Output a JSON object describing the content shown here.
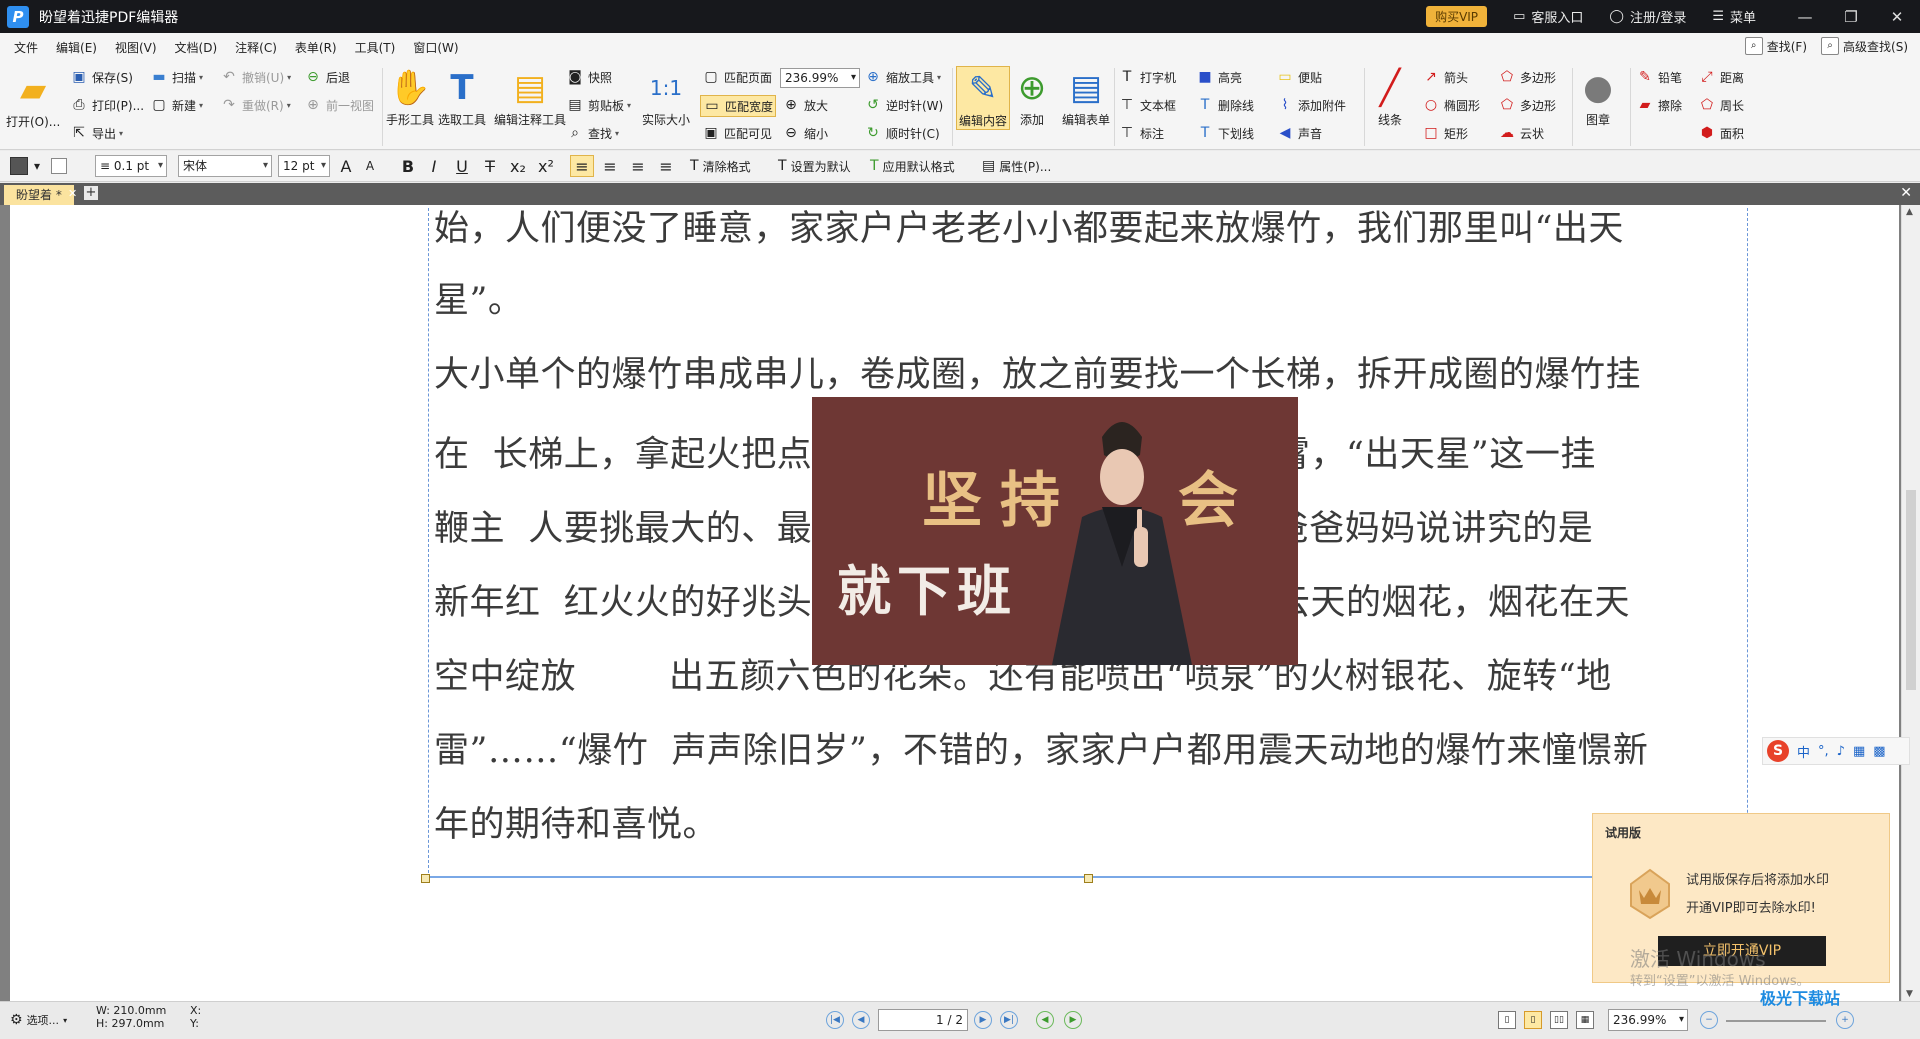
{
  "window": {
    "title": "盼望着迅捷PDF编辑器",
    "vip_button": "购买VIP",
    "service": "客服入口",
    "login": "注册/登录",
    "menu": "菜单"
  },
  "menubar": {
    "items": [
      "文件",
      "编辑(E)",
      "视图(V)",
      "文档(D)",
      "注释(C)",
      "表单(R)",
      "工具(T)",
      "窗口(W)"
    ],
    "find": "查找(F)",
    "advanced_find": "高级查找(S)"
  },
  "ribbon": {
    "open": "打开(O)...",
    "save": "保存(S)",
    "print": "打印(P)...",
    "export": "导出",
    "scan": "扫描",
    "new": "新建",
    "undo": "撤销(U)",
    "redo": "重做(R)",
    "back": "后退",
    "prev_view": "前一视图",
    "hand_tool": "手形工具",
    "select_tool": "选取工具",
    "annot_select": "编辑注释工具",
    "snapshot": "快照",
    "clipboard": "剪贴板",
    "find": "查找",
    "actual_size": "实际大小",
    "fit_page": "匹配页面",
    "fit_width": "匹配宽度",
    "fit_visible": "匹配可见",
    "zoom_value": "236.99%",
    "zoom_in": "放大",
    "zoom_out": "缩小",
    "zoom_tool": "缩放工具",
    "rotate_ccw": "逆时针(W)",
    "rotate_cw": "顺时针(C)",
    "edit_content": "编辑内容",
    "add": "添加",
    "edit_form": "编辑表单",
    "typewriter": "打字机",
    "textbox": "文本框",
    "callout": "标注",
    "highlight": "高亮",
    "strikeout": "删除线",
    "underline": "下划线",
    "note": "便贴",
    "attach": "添加附件",
    "sound": "声音",
    "line": "线条",
    "arrow": "箭头",
    "ellipse": "椭圆形",
    "rect": "矩形",
    "polygon": "多边形",
    "polyline": "多边形",
    "cloud": "云状",
    "stamp": "图章",
    "pencil": "铅笔",
    "eraser": "擦除",
    "distance": "距离",
    "perimeter": "周长",
    "area": "面积"
  },
  "formatbar": {
    "line_width": "0.1 pt",
    "font": "宋体",
    "size": "12 pt",
    "clear_format": "清除格式",
    "set_default": "设置为默认",
    "apply_default": "应用默认格式",
    "properties": "属性(P)..."
  },
  "tabs": {
    "doc": "盼望着 *"
  },
  "document": {
    "lines": [
      "始，人们便没了睡意，家家户户老老小小都要起来放爆竹，我们那里叫“出天",
      "星”。",
      "大小单个的爆竹串成串儿，卷成圈，放之前要找一个长梯，拆开成圈的爆竹挂",
      "在  长梯上，拿起火把点燃导火线，“噼里啪啦”响彻云霄，“出天星”这一挂",
      "鞭主  人要挑最大的、最响的，点火把也要挑旺的，听爸爸妈妈说讲究的是",
      "新年红  红火火的好兆头。“出天星”后我们还放了直窜云天的烟花，烟花在天",
      "空中绽放        出五颜六色的花朵。还有能喷出“喷泉”的火树银花、旋转“地",
      "雷”……“爆竹  声声除旧岁”，不错的，家家户户都用震天动地的爆竹来憧憬新",
      "年的期待和喜悦。"
    ],
    "overlay_text1": "坚持",
    "overlay_text2": "会",
    "overlay_text3": "就下班"
  },
  "trial": {
    "title": "试用版",
    "line1": "试用版保存后将添加水印",
    "line2": "开通VIP即可去除水印!",
    "button": "立即开通VIP",
    "watermark1": "激活 Windows",
    "watermark2": "转到“设置”以激活 Windows。"
  },
  "ime": {
    "zh": "中",
    "punct": "°,"
  },
  "statusbar": {
    "options": "选项...",
    "width": "W: 210.0mm",
    "height": "H: 297.0mm",
    "x": "X:",
    "y": "Y:",
    "page": "1 / 2",
    "zoom": "236.99%",
    "site_watermark": "极光下载站"
  }
}
